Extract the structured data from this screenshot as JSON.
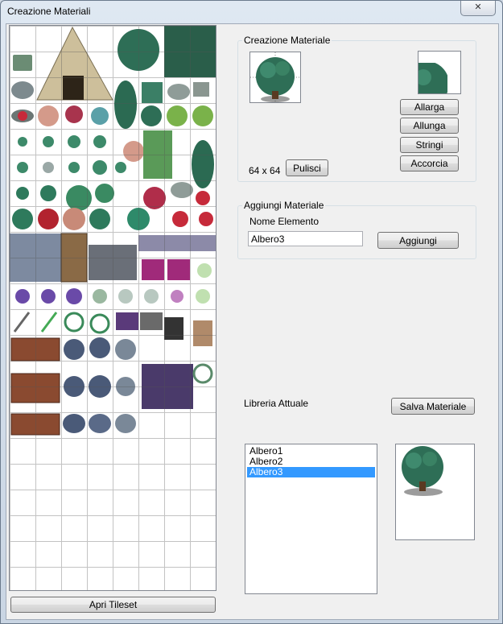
{
  "window": {
    "title": "Creazione Materiali",
    "close_glyph": "✕"
  },
  "tileset": {
    "open_button": "Apri Tileset"
  },
  "creazione": {
    "group_title": "Creazione Materiale",
    "size_label": "64 x 64",
    "clear_button": "Pulisci",
    "buttons": {
      "allarga": "Allarga",
      "allunga": "Allunga",
      "stringi": "Stringi",
      "accorcia": "Accorcia"
    }
  },
  "aggiungi": {
    "group_title": "Aggiungi Materiale",
    "name_label": "Nome Elemento",
    "name_value": "Albero3",
    "add_button": "Aggiungi"
  },
  "libreria": {
    "label": "Libreria Attuale",
    "save_button": "Salva Materiale",
    "items": [
      "Albero1",
      "Albero2",
      "Albero3"
    ],
    "selected_index": 2
  },
  "colors": {
    "tree_dark": "#1f4d3c",
    "tree_light": "#3f8a6e",
    "selection": "#3399ff"
  }
}
